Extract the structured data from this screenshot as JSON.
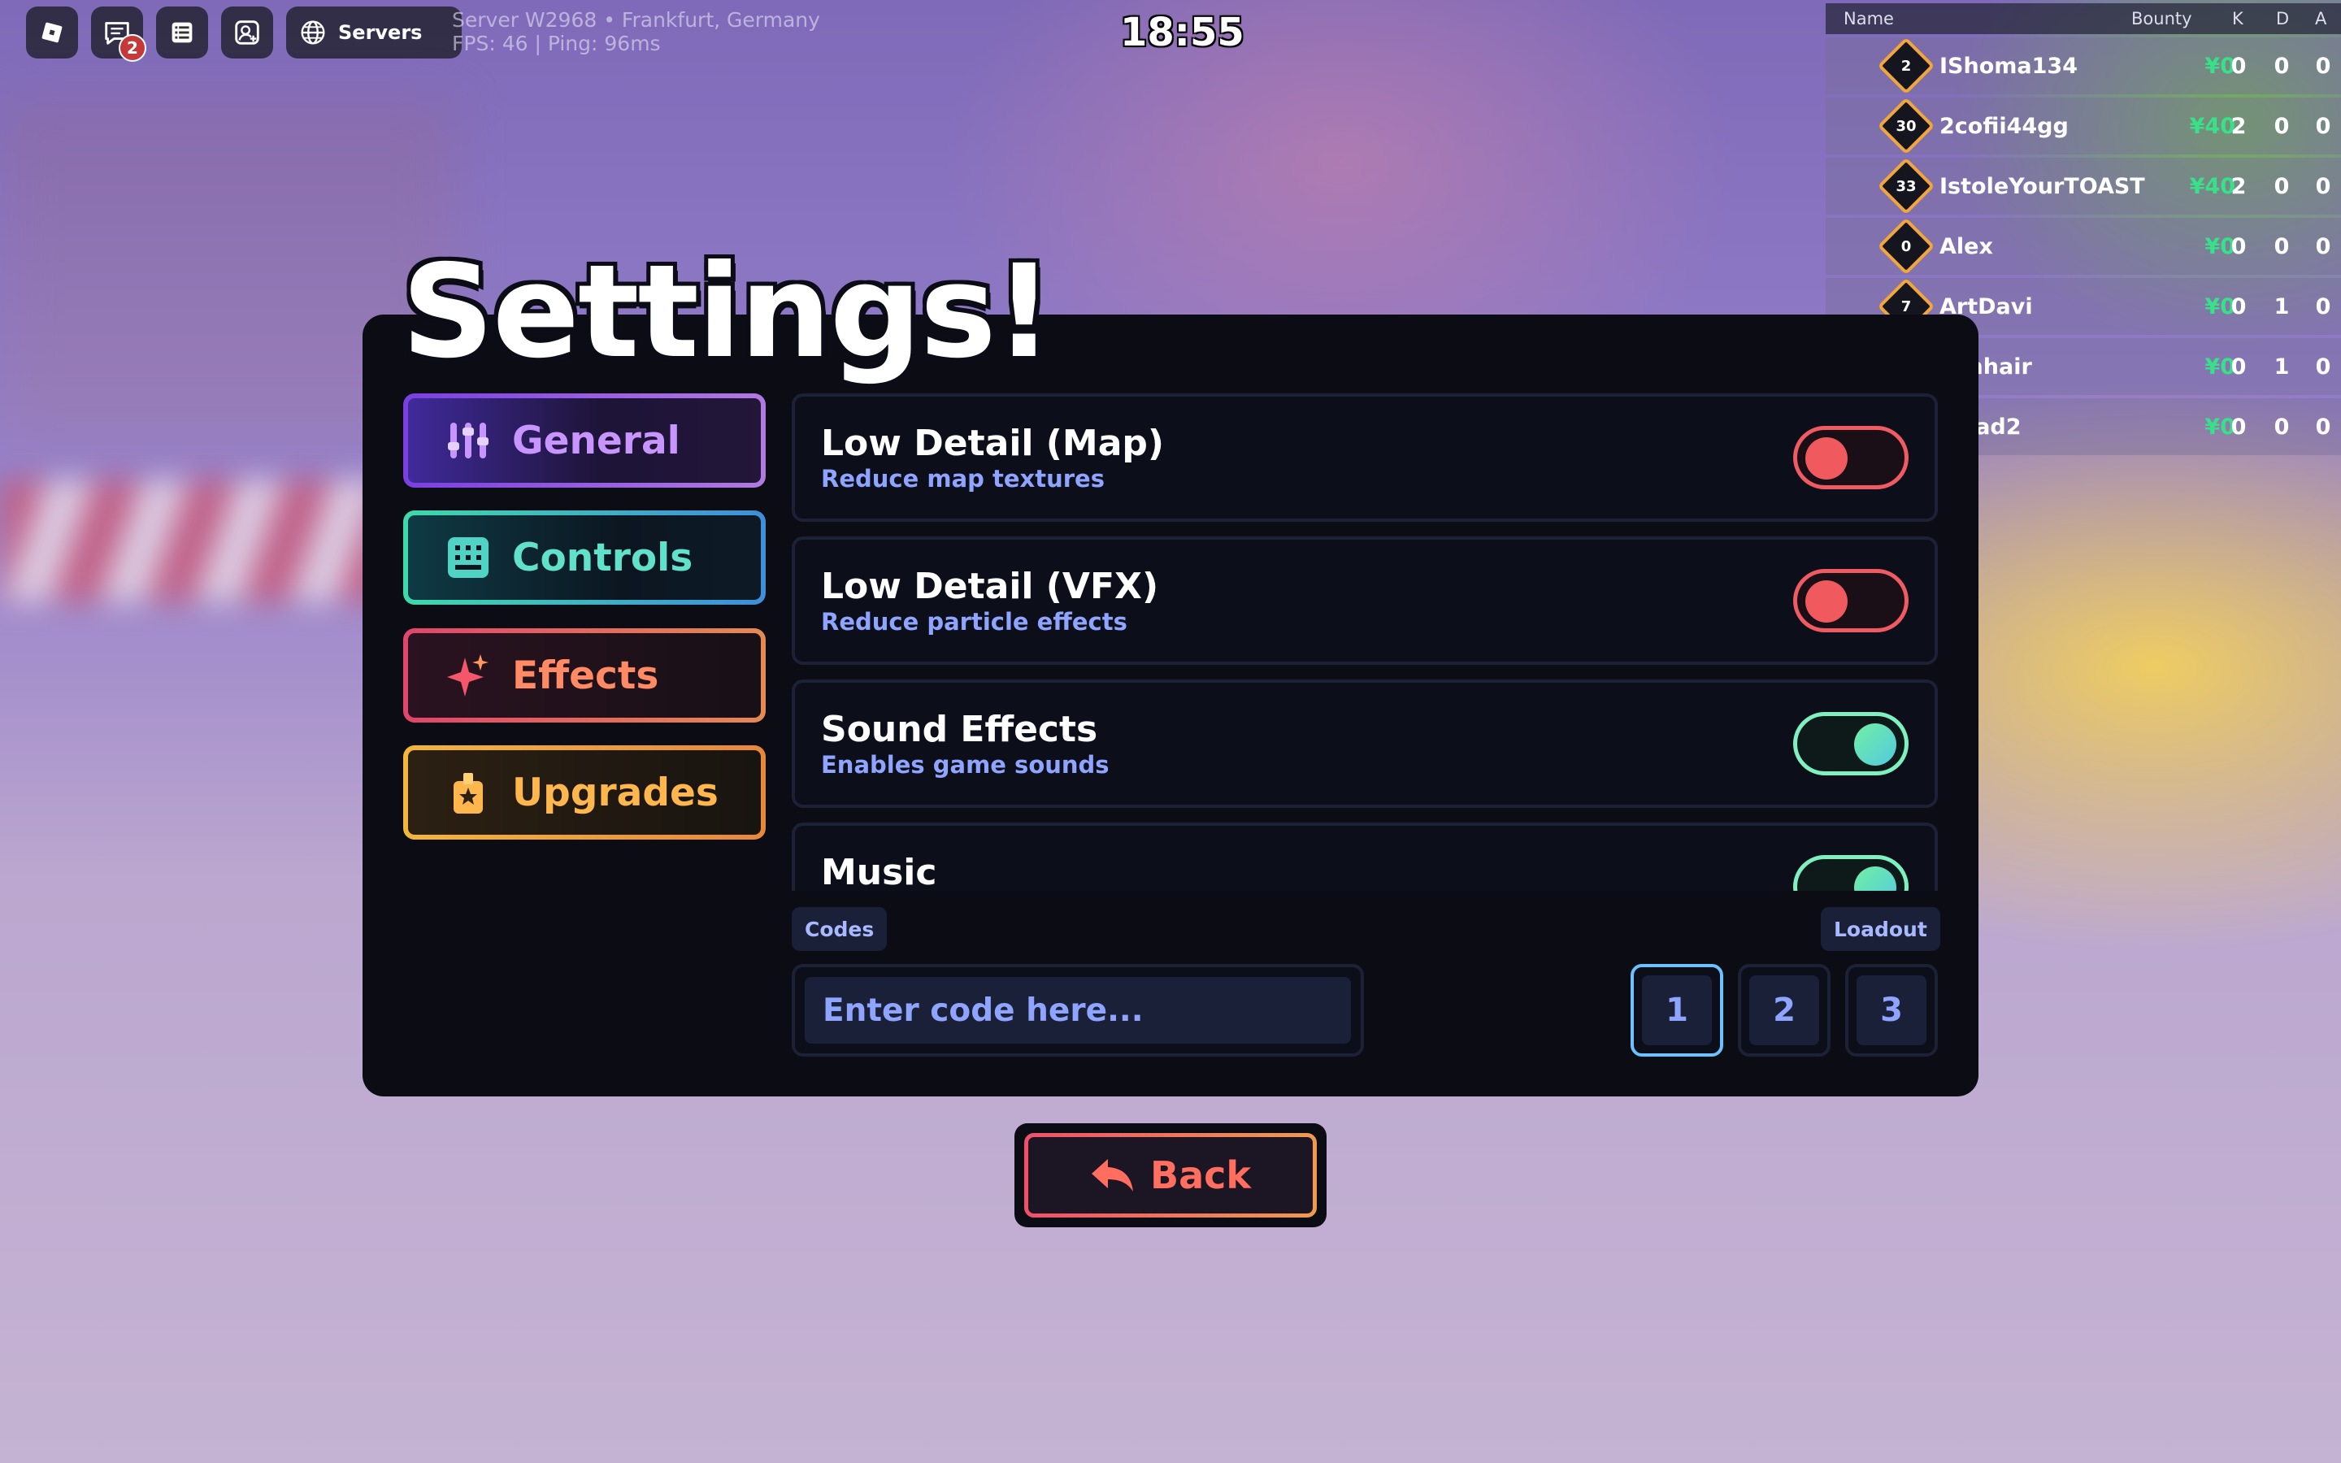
{
  "topbar": {
    "servers_label": "Servers",
    "chat_badge": "2",
    "server_info_line1": "Server W2968 • Frankfurt, Germany",
    "server_info_line2": "FPS: 46 | Ping: 96ms",
    "clock": "18:55"
  },
  "leaderboard": {
    "headers": {
      "name": "Name",
      "bounty": "Bounty",
      "k": "K",
      "d": "D",
      "a": "A"
    },
    "rows": [
      {
        "rank": "2",
        "name": "IShoma134",
        "bounty": "¥0",
        "k": "0",
        "d": "0",
        "a": "0"
      },
      {
        "rank": "30",
        "name": "2cofii44gg",
        "bounty": "¥40",
        "k": "2",
        "d": "0",
        "a": "0"
      },
      {
        "rank": "33",
        "name": "IstoleYourTOAST",
        "bounty": "¥40",
        "k": "2",
        "d": "0",
        "a": "0"
      },
      {
        "rank": "0",
        "name": "Alex",
        "bounty": "¥0",
        "k": "0",
        "d": "0",
        "a": "0"
      },
      {
        "rank": "7",
        "name": "ArtDavi",
        "bounty": "¥0",
        "k": "0",
        "d": "1",
        "a": "0"
      },
      {
        "rank": "",
        "name": "conhair",
        "bounty": "¥0",
        "k": "0",
        "d": "1",
        "a": "0"
      },
      {
        "rank": "",
        "name": "smad2",
        "bounty": "¥0",
        "k": "0",
        "d": "0",
        "a": "0"
      }
    ]
  },
  "settings": {
    "title": "Settings!",
    "nav": {
      "general": "General",
      "controls": "Controls",
      "effects": "Effects",
      "upgrades": "Upgrades"
    },
    "options": [
      {
        "name": "Low Detail (Map)",
        "desc": "Reduce map textures",
        "on": false
      },
      {
        "name": "Low Detail (VFX)",
        "desc": "Reduce particle effects",
        "on": false
      },
      {
        "name": "Sound Effects",
        "desc": "Enables game sounds",
        "on": true
      },
      {
        "name": "Music",
        "desc": "",
        "on": true
      }
    ],
    "codes_label": "Codes",
    "code_placeholder": "Enter code here...",
    "loadout_label": "Loadout",
    "loadouts": [
      "1",
      "2",
      "3"
    ],
    "active_loadout": "1"
  },
  "back_label": "Back",
  "colors": {
    "panel": "#0b0c14",
    "toggle_off": "#f05a62",
    "toggle_on": "#7ff0c0",
    "subtext": "#8ea4ff",
    "bounty": "#39e08a"
  }
}
